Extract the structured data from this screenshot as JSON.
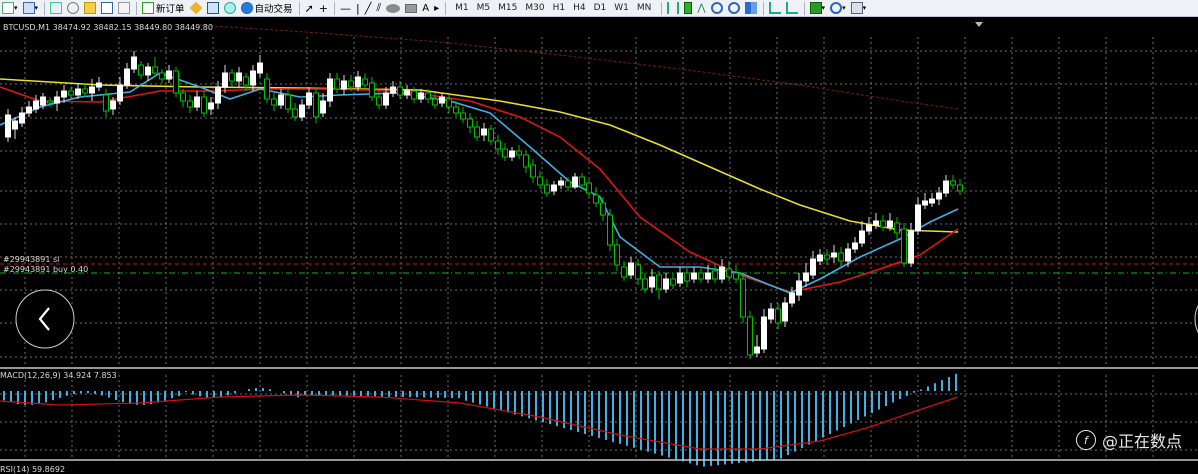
{
  "toolbar": {
    "new_order_label": "新订单",
    "auto_trading_label": "自动交易",
    "timeframes": [
      "M1",
      "M5",
      "M15",
      "M30",
      "H1",
      "H4",
      "D1",
      "W1",
      "MN"
    ]
  },
  "chart": {
    "symbol_info": "BTCUSD,M1  38474.92 38482.15 38449.80 38449.80",
    "order_sl_label": "#29943891 sl",
    "order_buy_label": "#29943891 buy 0.40",
    "macd_label": "MACD(12,26,9) 34.924 7.853",
    "rsi_label": "RSI(14) 59.8692"
  },
  "nav": {
    "prev_icon": "chevron-left-icon",
    "next_icon": "chevron-right-icon"
  },
  "watermark": {
    "text": "@正在数点"
  },
  "colors": {
    "bull": "#ffffff",
    "bear": "#00c000",
    "ma_fast": "#3fb0e6",
    "ma_mid": "#e01515",
    "ma_slow": "#e8dd30",
    "ma_long": "#7a1b1b",
    "macd_hist": "#3fb0e6",
    "macd_signal": "#d01010",
    "grid": "#6e6e6e"
  }
}
